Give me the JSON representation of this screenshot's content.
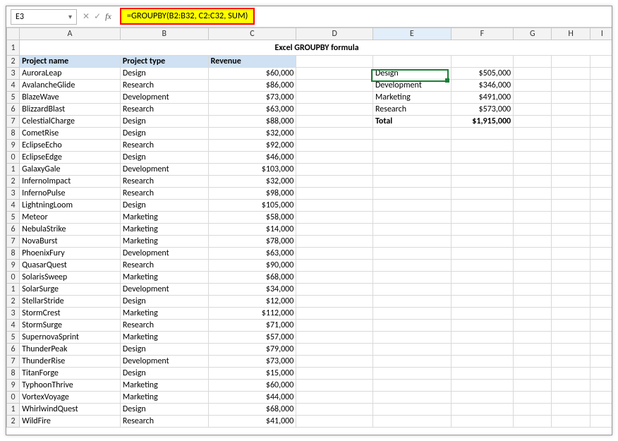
{
  "namebox": {
    "value": "E3"
  },
  "formula_bar": {
    "formula": "=GROUPBY(B2:B32, C2:C32, SUM)"
  },
  "columns": [
    "A",
    "B",
    "C",
    "D",
    "E",
    "F",
    "G",
    "H",
    "I"
  ],
  "title": "Excel GROUPBY formula",
  "headers": {
    "A": "Project name",
    "B": "Project type",
    "C": "Revenue"
  },
  "rows": [
    {
      "n": "3",
      "name": "AuroraLeap",
      "type": "Design",
      "rev": "$60,000"
    },
    {
      "n": "4",
      "name": "AvalancheGlide",
      "type": "Research",
      "rev": "$86,000"
    },
    {
      "n": "5",
      "name": "BlazeWave",
      "type": "Development",
      "rev": "$73,000"
    },
    {
      "n": "6",
      "name": "BlizzardBlast",
      "type": "Research",
      "rev": "$63,000"
    },
    {
      "n": "7",
      "name": "CelestialCharge",
      "type": "Design",
      "rev": "$88,000"
    },
    {
      "n": "8",
      "name": "CometRise",
      "type": "Design",
      "rev": "$32,000"
    },
    {
      "n": "9",
      "name": "EclipseEcho",
      "type": "Research",
      "rev": "$92,000"
    },
    {
      "n": "0",
      "name": "EclipseEdge",
      "type": "Design",
      "rev": "$46,000"
    },
    {
      "n": "1",
      "name": "GalaxyGale",
      "type": "Development",
      "rev": "$103,000"
    },
    {
      "n": "2",
      "name": "InfernoImpact",
      "type": "Research",
      "rev": "$32,000"
    },
    {
      "n": "3",
      "name": "InfernoPulse",
      "type": "Research",
      "rev": "$98,000"
    },
    {
      "n": "4",
      "name": "LightningLoom",
      "type": "Design",
      "rev": "$105,000"
    },
    {
      "n": "5",
      "name": "Meteor",
      "type": "Marketing",
      "rev": "$58,000"
    },
    {
      "n": "6",
      "name": "NebulaStrike",
      "type": "Marketing",
      "rev": "$14,000"
    },
    {
      "n": "7",
      "name": "NovaBurst",
      "type": "Marketing",
      "rev": "$78,000"
    },
    {
      "n": "8",
      "name": "PhoenixFury",
      "type": "Development",
      "rev": "$63,000"
    },
    {
      "n": "9",
      "name": "QuasarQuest",
      "type": "Research",
      "rev": "$90,000"
    },
    {
      "n": "0",
      "name": "SolarisSweep",
      "type": "Marketing",
      "rev": "$68,000"
    },
    {
      "n": "1",
      "name": "SolarSurge",
      "type": "Development",
      "rev": "$34,000"
    },
    {
      "n": "2",
      "name": "StellarStride",
      "type": "Design",
      "rev": "$12,000"
    },
    {
      "n": "3",
      "name": "StormCrest",
      "type": "Marketing",
      "rev": "$112,000"
    },
    {
      "n": "4",
      "name": "StormSurge",
      "type": "Research",
      "rev": "$71,000"
    },
    {
      "n": "5",
      "name": "SupernovaSprint",
      "type": "Marketing",
      "rev": "$57,000"
    },
    {
      "n": "6",
      "name": "ThunderPeak",
      "type": "Design",
      "rev": "$79,000"
    },
    {
      "n": "7",
      "name": "ThunderRise",
      "type": "Development",
      "rev": "$73,000"
    },
    {
      "n": "8",
      "name": "TitanForge",
      "type": "Design",
      "rev": "$15,000"
    },
    {
      "n": "9",
      "name": "TyphoonThrive",
      "type": "Marketing",
      "rev": "$60,000"
    },
    {
      "n": "0",
      "name": "VortexVoyage",
      "type": "Marketing",
      "rev": "$44,000"
    },
    {
      "n": "1",
      "name": "WhirlwindQuest",
      "type": "Design",
      "rev": "$68,000"
    },
    {
      "n": "2",
      "name": "WildFire",
      "type": "Research",
      "rev": "$41,000"
    }
  ],
  "result": [
    {
      "label": "Design",
      "value": "$505,000"
    },
    {
      "label": "Development",
      "value": "$346,000"
    },
    {
      "label": "Marketing",
      "value": "$491,000"
    },
    {
      "label": "Research",
      "value": "$573,000"
    },
    {
      "label": "Total",
      "value": "$1,915,000"
    }
  ],
  "chart_data": {
    "type": "table",
    "title": "Excel GROUPBY formula",
    "columns": [
      "Project name",
      "Project type",
      "Revenue"
    ],
    "data": [
      [
        "AuroraLeap",
        "Design",
        60000
      ],
      [
        "AvalancheGlide",
        "Research",
        86000
      ],
      [
        "BlazeWave",
        "Development",
        73000
      ],
      [
        "BlizzardBlast",
        "Research",
        63000
      ],
      [
        "CelestialCharge",
        "Design",
        88000
      ],
      [
        "CometRise",
        "Design",
        32000
      ],
      [
        "EclipseEcho",
        "Research",
        92000
      ],
      [
        "EclipseEdge",
        "Design",
        46000
      ],
      [
        "GalaxyGale",
        "Development",
        103000
      ],
      [
        "InfernoImpact",
        "Research",
        32000
      ],
      [
        "InfernoPulse",
        "Research",
        98000
      ],
      [
        "LightningLoom",
        "Design",
        105000
      ],
      [
        "Meteor",
        "Marketing",
        58000
      ],
      [
        "NebulaStrike",
        "Marketing",
        14000
      ],
      [
        "NovaBurst",
        "Marketing",
        78000
      ],
      [
        "PhoenixFury",
        "Development",
        63000
      ],
      [
        "QuasarQuest",
        "Research",
        90000
      ],
      [
        "SolarisSweep",
        "Marketing",
        68000
      ],
      [
        "SolarSurge",
        "Development",
        34000
      ],
      [
        "StellarStride",
        "Design",
        12000
      ],
      [
        "StormCrest",
        "Marketing",
        112000
      ],
      [
        "StormSurge",
        "Research",
        71000
      ],
      [
        "SupernovaSprint",
        "Marketing",
        57000
      ],
      [
        "ThunderPeak",
        "Design",
        79000
      ],
      [
        "ThunderRise",
        "Development",
        73000
      ],
      [
        "TitanForge",
        "Design",
        15000
      ],
      [
        "TyphoonThrive",
        "Marketing",
        60000
      ],
      [
        "VortexVoyage",
        "Marketing",
        44000
      ],
      [
        "WhirlwindQuest",
        "Design",
        68000
      ],
      [
        "WildFire",
        "Research",
        41000
      ]
    ],
    "group_summary": [
      [
        "Design",
        505000
      ],
      [
        "Development",
        346000
      ],
      [
        "Marketing",
        491000
      ],
      [
        "Research",
        573000
      ],
      [
        "Total",
        1915000
      ]
    ]
  }
}
